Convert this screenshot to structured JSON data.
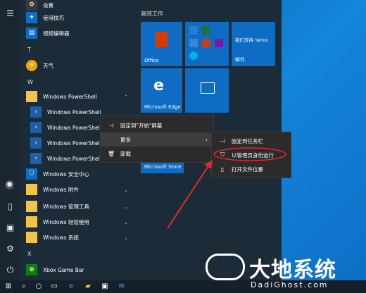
{
  "start_menu": {
    "letters": {
      "t": "T",
      "w": "W",
      "x": "X"
    },
    "apps": {
      "settings": "设置",
      "tips": "使用技巧",
      "video_editor": "视频编辑器",
      "weather": "天气",
      "ps_group": "Windows PowerShell",
      "ps1": "Windows PowerShell",
      "ps2": "Windows PowerShell",
      "ps3": "Windows PowerShell",
      "ps4": "Windows PowerShell",
      "security": "Windows 安全中心",
      "accessories": "Windows 附件",
      "admin_tools": "Windows 管理工具",
      "ease": "Windows 轻松使用",
      "system": "Windows 系统",
      "xbox": "Xbox Game Bar"
    },
    "tiles_group_title": "高效工作",
    "tiles": {
      "office": "Office",
      "yahoo": "我们支持 Yahoo",
      "mail": "邮件",
      "edge": "Microsoft Edge",
      "store": "Microsoft Store"
    }
  },
  "context_menu": {
    "pin_start": "固定到\"开始\"屏幕",
    "more": "更多",
    "uninstall": "卸载"
  },
  "submenu": {
    "pin_taskbar": "固定到任务栏",
    "run_admin": "以管理员身份运行",
    "open_location": "打开文件位置"
  },
  "watermark": {
    "main": "大地系统",
    "url": "DadiGhost.com"
  },
  "colors": {
    "accent": "#0f6cc4",
    "highlight": "#e02a2a"
  }
}
